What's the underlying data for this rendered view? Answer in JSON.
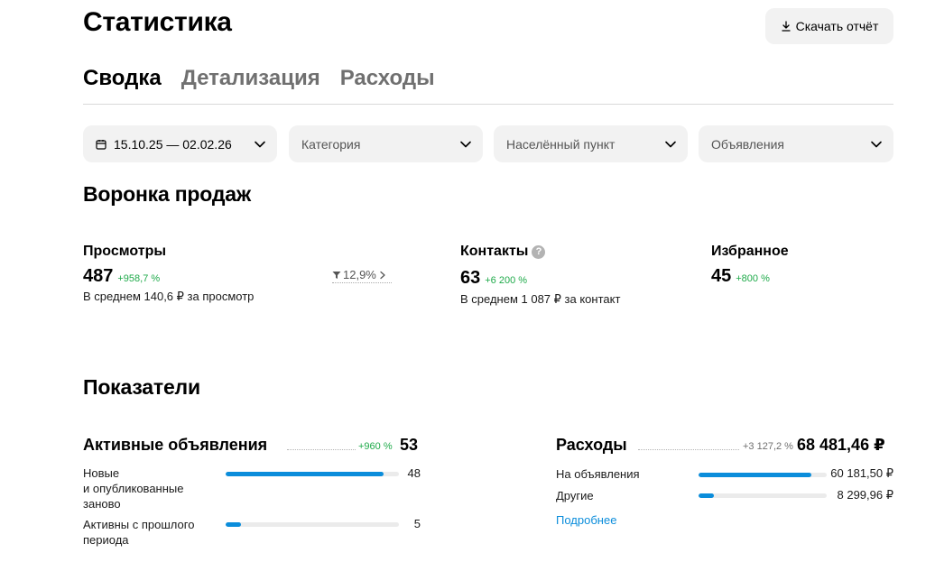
{
  "page": {
    "title": "Статистика"
  },
  "header": {
    "download_label": "Скачать отчёт",
    "download_icon": "download-icon"
  },
  "tabs": [
    {
      "label": "Сводка",
      "active": true
    },
    {
      "label": "Детализация",
      "active": false
    },
    {
      "label": "Расходы",
      "active": false
    }
  ],
  "filters": {
    "date": {
      "value": "15.10.25 — 02.02.26",
      "icon": "calendar-icon"
    },
    "category": {
      "placeholder": "Категория"
    },
    "city": {
      "placeholder": "Населённый пункт"
    },
    "ads": {
      "placeholder": "Объявления"
    }
  },
  "funnel": {
    "title": "Воронка продаж",
    "views": {
      "label": "Просмотры",
      "value": "487",
      "change": "+958,7 %",
      "sub": "В среднем 140,6 ₽ за просмотр"
    },
    "conversion": {
      "value": "12,9%",
      "icon": "funnel-icon"
    },
    "contacts": {
      "label": "Контакты",
      "help": "?",
      "value": "63",
      "change": "+6 200 %",
      "sub": "В среднем 1 087 ₽ за контакт"
    },
    "favorites": {
      "label": "Избранное",
      "value": "45",
      "change": "+800 %"
    }
  },
  "indicators": {
    "title": "Показатели",
    "active_ads": {
      "title": "Активные объявления",
      "change": "+960 %",
      "total": "53",
      "rows": [
        {
          "label": "Новые\nи опубликованные\nзаново",
          "value": "48",
          "fraction": 0.91
        },
        {
          "label": "Активны с прошлого\nпериода",
          "value": "5",
          "fraction": 0.09
        }
      ]
    },
    "expenses": {
      "title": "Расходы",
      "change": "+3 127,2 %",
      "total": "68 481,46 ₽",
      "rows": [
        {
          "label": "На объявления",
          "value": "60 181,50 ₽",
          "fraction": 0.88
        },
        {
          "label": "Другие",
          "value": "8 299,96 ₽",
          "fraction": 0.12
        }
      ],
      "more_label": "Подробнее"
    }
  },
  "colors": {
    "positive": "#1faa4a",
    "accent": "#0b8ddb",
    "muted_change": "#707070"
  }
}
